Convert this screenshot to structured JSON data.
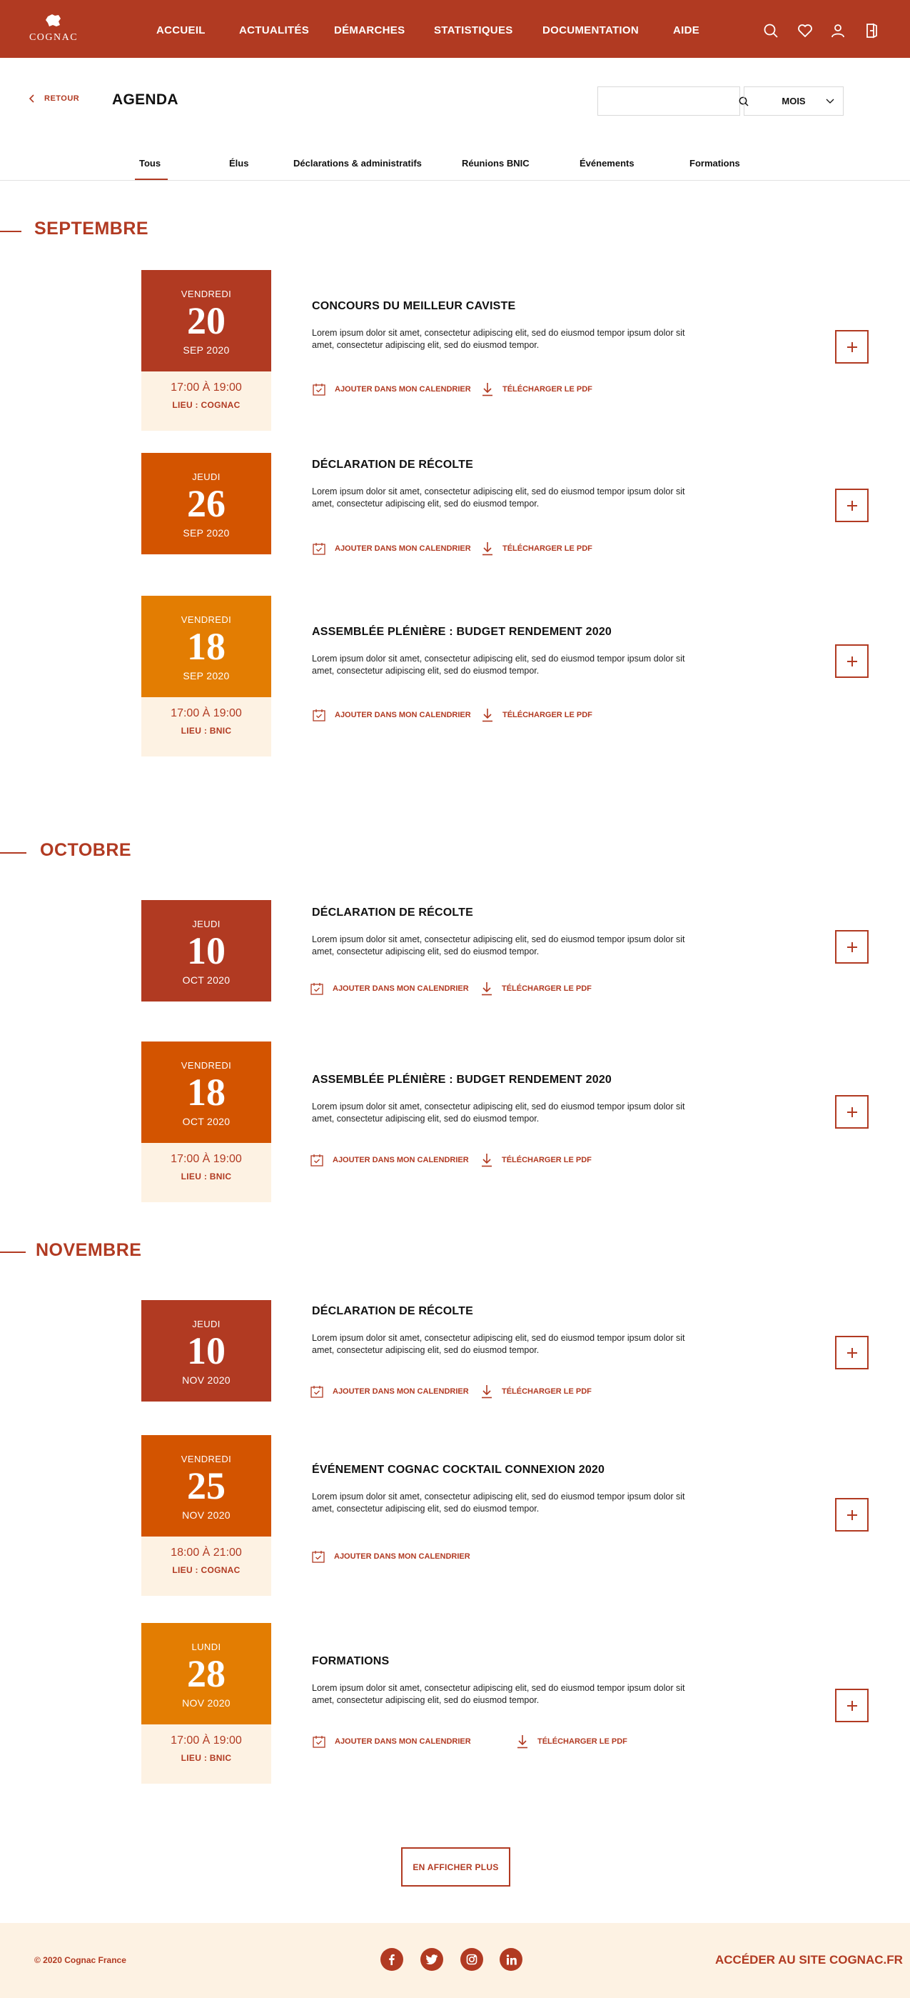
{
  "brand": {
    "name": "COGNAC",
    "primary": "#b13a22",
    "orange": "#d35400",
    "amber": "#e37d02",
    "cream": "#fdf2e3"
  },
  "nav": [
    "ACCUEIL",
    "ACTUALITÉS",
    "DÉMARCHES",
    "STATISTIQUES",
    "DOCUMENTATION",
    "AIDE"
  ],
  "header_icons": [
    "search-icon",
    "heart-icon",
    "user-icon",
    "logout-icon"
  ],
  "back_label": "RETOUR",
  "page_title": "AGENDA",
  "search": {
    "placeholder": "",
    "value": ""
  },
  "period_select": {
    "selected": "MOIS"
  },
  "tabs": [
    "Tous",
    "Élus",
    "Déclarations & administratifs",
    "Réunions BNIC",
    "Événements",
    "Formations"
  ],
  "active_tab": "Tous",
  "months": [
    "SEPTEMBRE",
    "OCTOBRE",
    "NOVEMBRE"
  ],
  "actions": {
    "calendar": "AJOUTER DANS MON CALENDRIER",
    "pdf": "TÉLÉCHARGER LE PDF"
  },
  "events": [
    {
      "dow": "VENDREDI",
      "day": "20",
      "month_year": "SEP 2020",
      "time": "17:00 À 19:00",
      "place": "LIEU : COGNAC",
      "title": "CONCOURS DU MEILLEUR CAVISTE",
      "desc": "Lorem ipsum dolor sit amet, consectetur adipiscing elit, sed do eiusmod tempor  ipsum dolor sit amet, consectetur adipiscing elit, sed do eiusmod tempor."
    },
    {
      "dow": "JEUDI",
      "day": "26",
      "month_year": "SEP 2020",
      "time": "",
      "place": "",
      "title": "DÉCLARATION DE RÉCOLTE",
      "desc": "Lorem ipsum dolor sit amet, consectetur adipiscing elit, sed do eiusmod tempor  ipsum dolor sit amet, consectetur adipiscing elit, sed do eiusmod tempor."
    },
    {
      "dow": "VENDREDI",
      "day": "18",
      "month_year": "SEP 2020",
      "time": "17:00 À 19:00",
      "place": "LIEU : BNIC",
      "title": "ASSEMBLÉE PLÉNIÈRE : BUDGET RENDEMENT 2020",
      "desc": "Lorem ipsum dolor sit amet, consectetur adipiscing elit, sed do eiusmod tempor  ipsum dolor sit amet, consectetur adipiscing elit, sed do eiusmod tempor."
    },
    {
      "dow": "JEUDI",
      "day": "10",
      "month_year": "OCT 2020",
      "time": "",
      "place": "",
      "title": "DÉCLARATION DE RÉCOLTE",
      "desc": "Lorem ipsum dolor sit amet, consectetur adipiscing elit, sed do eiusmod tempor  ipsum dolor sit amet, consectetur adipiscing elit, sed do eiusmod tempor."
    },
    {
      "dow": "VENDREDI",
      "day": "18",
      "month_year": "OCT 2020",
      "time": "17:00 À 19:00",
      "place": "LIEU : BNIC",
      "title": "ASSEMBLÉE PLÉNIÈRE : BUDGET RENDEMENT 2020",
      "desc": "Lorem ipsum dolor sit amet, consectetur adipiscing elit, sed do eiusmod tempor  ipsum dolor sit amet, consectetur adipiscing elit, sed do eiusmod tempor."
    },
    {
      "dow": "JEUDI",
      "day": "10",
      "month_year": "NOV 2020",
      "time": "",
      "place": "",
      "title": "DÉCLARATION DE RÉCOLTE",
      "desc": "Lorem ipsum dolor sit amet, consectetur adipiscing elit, sed do eiusmod tempor  ipsum dolor sit amet, consectetur adipiscing elit, sed do eiusmod tempor."
    },
    {
      "dow": "VENDREDI",
      "day": "25",
      "month_year": "NOV 2020",
      "time": "18:00 À 21:00",
      "place": "LIEU : COGNAC",
      "title": "ÉVÉNEMENT COGNAC COCKTAIL CONNEXION 2020",
      "desc": "Lorem ipsum dolor sit amet, consectetur adipiscing elit, sed do eiusmod tempor  ipsum dolor sit amet, consectetur adipiscing elit, sed do eiusmod tempor."
    },
    {
      "dow": "LUNDI",
      "day": "28",
      "month_year": "NOV 2020",
      "time": "17:00 À 19:00",
      "place": "LIEU : BNIC",
      "title": "FORMATIONS",
      "desc": "Lorem ipsum dolor sit amet, consectetur adipiscing elit, sed do eiusmod tempor  ipsum dolor sit amet, consectetur adipiscing elit, sed do eiusmod tempor."
    }
  ],
  "more_label": "EN AFFICHER PLUS",
  "footer": {
    "copyright": "© 2020 Cognac France",
    "social": [
      "facebook-icon",
      "twitter-icon",
      "instagram-icon",
      "linkedin-icon"
    ],
    "site_link": "ACCÉDER AU SITE COGNAC.FR"
  }
}
